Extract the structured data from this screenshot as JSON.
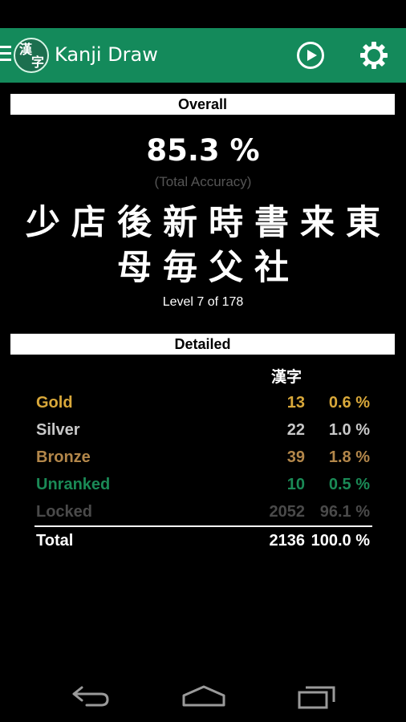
{
  "app": {
    "title": "Kanji Draw",
    "logo_chars": [
      "漢",
      "字"
    ],
    "accent_color": "#148a5b"
  },
  "icons": {
    "menu": "menu-icon",
    "play": "play-icon",
    "settings": "gear-icon"
  },
  "overall": {
    "header": "Overall",
    "accuracy": "85.3 %",
    "accuracy_caption": "(Total Accuracy)",
    "kanji_line1": "少店後新時書来東",
    "kanji_line2": "母毎父社",
    "level_text": "Level 7 of 178"
  },
  "detailed": {
    "header": "Detailed",
    "column_header": "漢字",
    "rows": [
      {
        "label": "Gold",
        "count": "13",
        "pct": "0.6 %",
        "color": "#d9a83a"
      },
      {
        "label": "Silver",
        "count": "22",
        "pct": "1.0 %",
        "color": "#c8c8c8"
      },
      {
        "label": "Bronze",
        "count": "39",
        "pct": "1.8 %",
        "color": "#b3874a"
      },
      {
        "label": "Unranked",
        "count": "10",
        "pct": "0.5 %",
        "color": "#1a8a56"
      },
      {
        "label": "Locked",
        "count": "2052",
        "pct": "96.1 %",
        "color": "#4a4a4a"
      }
    ],
    "total": {
      "label": "Total",
      "count": "2136",
      "pct": "100.0 %",
      "color": "#ffffff"
    }
  },
  "nav": {
    "back": "back-icon",
    "home": "home-icon",
    "recents": "recents-icon"
  }
}
